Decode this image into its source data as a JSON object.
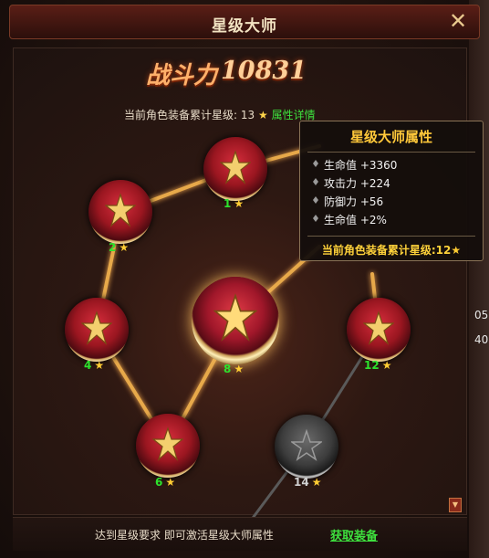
{
  "window": {
    "title": "星级大师",
    "close_label": "✕"
  },
  "power": {
    "label": "战斗力",
    "value": "10831"
  },
  "current": {
    "prefix": "当前角色装备累计星级:",
    "value": "13",
    "detail_link": "属性详情"
  },
  "nodes": [
    {
      "id": "node-1",
      "level": "1",
      "state": "active"
    },
    {
      "id": "node-2",
      "level": "2",
      "state": "active"
    },
    {
      "id": "node-4",
      "level": "4",
      "state": "active"
    },
    {
      "id": "node-6",
      "level": "6",
      "state": "active"
    },
    {
      "id": "node-8",
      "level": "8",
      "state": "active-selected"
    },
    {
      "id": "node-12",
      "level": "12",
      "state": "active"
    },
    {
      "id": "node-14",
      "level": "14",
      "state": "locked"
    }
  ],
  "tooltip": {
    "title": "星级大师属性",
    "rows": [
      "生命值 +3360",
      "攻击力 +224",
      "防御力 +56",
      "生命值 +2%"
    ],
    "footer_prefix": "当前角色装备累计星级:",
    "footer_value": "12"
  },
  "side_numbers": [
    "05",
    "40"
  ],
  "bottom": {
    "hint": "达到星级要求 即可激活星级大师属性",
    "action": "获取装备"
  },
  "colors": {
    "green": "#3ee13e",
    "gold": "#ffcc33",
    "accent": "#ffc83a"
  }
}
